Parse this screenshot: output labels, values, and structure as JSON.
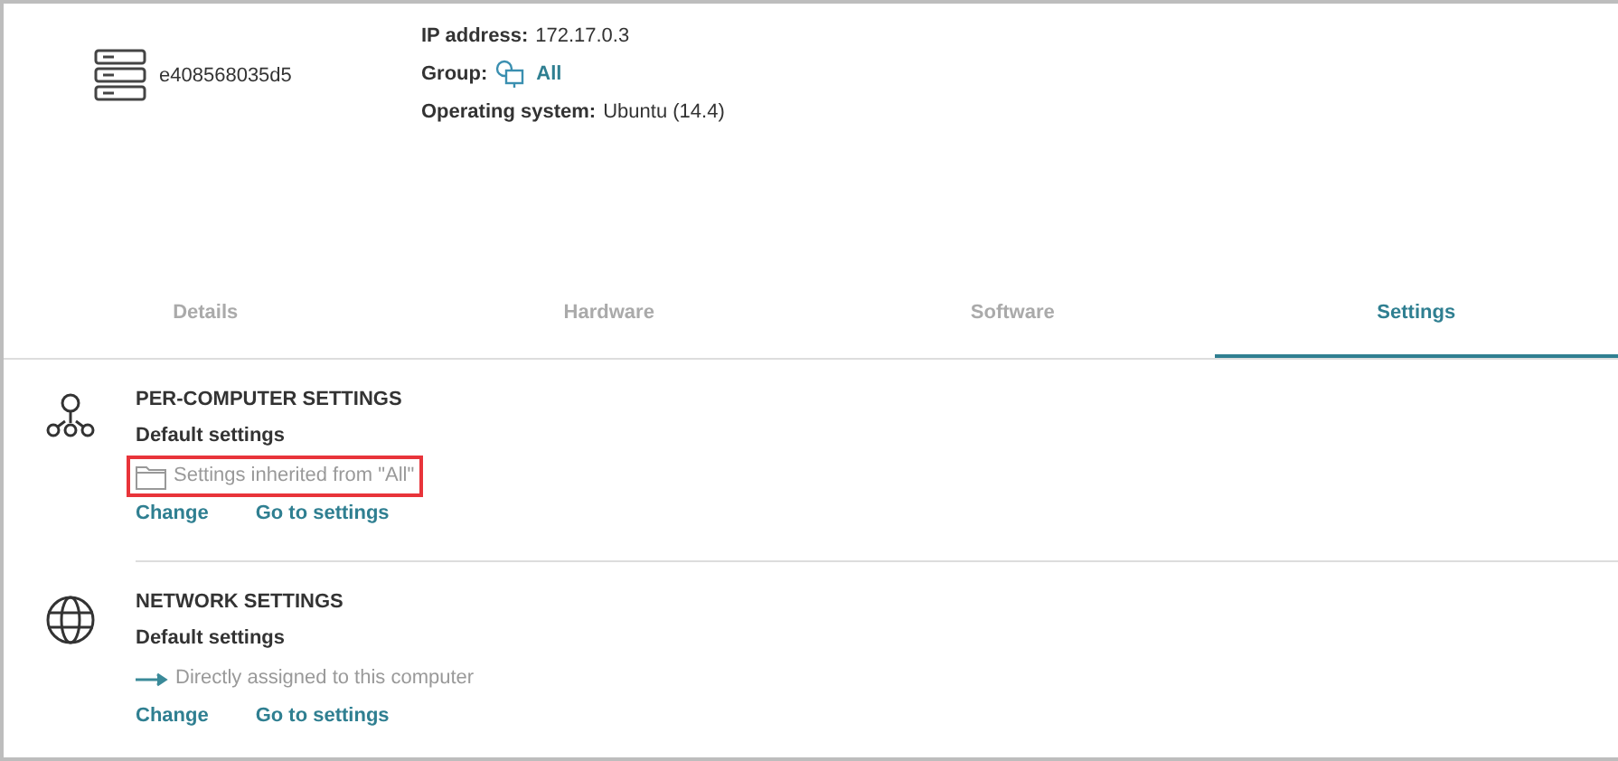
{
  "device": {
    "name": "e408568035d5",
    "info": [
      {
        "label": "IP address:",
        "value": "172.17.0.3",
        "kind": "text"
      },
      {
        "label": "Group:",
        "value": "All",
        "kind": "group"
      },
      {
        "label": "Operating system:",
        "value": "Ubuntu (14.4)",
        "kind": "text"
      }
    ]
  },
  "tabs": [
    {
      "label": "Details",
      "selected": false
    },
    {
      "label": "Hardware",
      "selected": false
    },
    {
      "label": "Software",
      "selected": false
    },
    {
      "label": "Settings",
      "selected": true
    }
  ],
  "sections": [
    {
      "kind": "hierarchy",
      "title": "PER-COMPUTER SETTINGS",
      "subtitle": "Default settings",
      "source": {
        "kind": "folder",
        "text": "Settings inherited from \"All\"",
        "highlighted": true
      },
      "links": [
        "Change",
        "Go to settings"
      ]
    },
    {
      "kind": "network",
      "title": "NETWORK SETTINGS",
      "subtitle": "Default settings",
      "source": {
        "kind": "arrow",
        "text": "Directly assigned to this computer",
        "highlighted": false
      },
      "links": [
        "Change",
        "Go to settings"
      ]
    }
  ]
}
